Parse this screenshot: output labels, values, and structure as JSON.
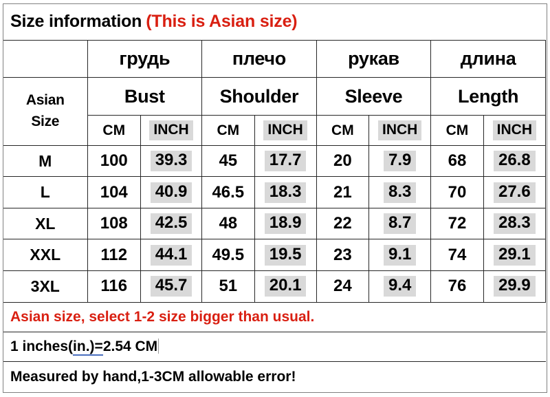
{
  "title": {
    "main": "Size information",
    "accent": "(This is Asian size)"
  },
  "table": {
    "corner_label": "Asian Size",
    "corner_label_line1": "Asian",
    "corner_label_line2": "Size",
    "russian_headers": [
      "грудь",
      "плечо",
      "рукав",
      "длина"
    ],
    "english_headers": [
      "Bust",
      "Shoulder",
      "Sleeve",
      "Length"
    ],
    "unit_headers": [
      "CM",
      "INCH",
      "CM",
      "INCH",
      "CM",
      "INCH",
      "CM",
      "INCH"
    ],
    "unit_cm": "CM",
    "unit_inch": "INCH",
    "rows": [
      {
        "size": "M",
        "bust_cm": "100",
        "bust_inch": "39.3",
        "shoulder_cm": "45",
        "shoulder_inch": "17.7",
        "sleeve_cm": "20",
        "sleeve_inch": "7.9",
        "length_cm": "68",
        "length_inch": "26.8"
      },
      {
        "size": "L",
        "bust_cm": "104",
        "bust_inch": "40.9",
        "shoulder_cm": "46.5",
        "shoulder_inch": "18.3",
        "sleeve_cm": "21",
        "sleeve_inch": "8.3",
        "length_cm": "70",
        "length_inch": "27.6"
      },
      {
        "size": "XL",
        "bust_cm": "108",
        "bust_inch": "42.5",
        "shoulder_cm": "48",
        "shoulder_inch": "18.9",
        "sleeve_cm": "22",
        "sleeve_inch": "8.7",
        "length_cm": "72",
        "length_inch": "28.3"
      },
      {
        "size": "XXL",
        "bust_cm": "112",
        "bust_inch": "44.1",
        "shoulder_cm": "49.5",
        "shoulder_inch": "19.5",
        "sleeve_cm": "23",
        "sleeve_inch": "9.1",
        "length_cm": "74",
        "length_inch": "29.1"
      },
      {
        "size": "3XL",
        "bust_cm": "116",
        "bust_inch": "45.7",
        "shoulder_cm": "51",
        "shoulder_inch": "20.1",
        "sleeve_cm": "24",
        "sleeve_inch": "9.4",
        "length_cm": "76",
        "length_inch": "29.9"
      }
    ]
  },
  "notes": {
    "line1": "Asian size, select 1-2 size bigger than usual.",
    "line2_prefix": "1 inches(",
    "line2_tag": "in.)=",
    "line2_suffix": "2.54 CM",
    "line3": "Measured by hand,1-3CM allowable error!"
  },
  "colors": {
    "accent_red": "#d91f11",
    "highlight_gray": "#d9d9d9",
    "grid_line": "#262626",
    "frame": "#808080",
    "smart_tag_underline": "#4a6fbf"
  }
}
